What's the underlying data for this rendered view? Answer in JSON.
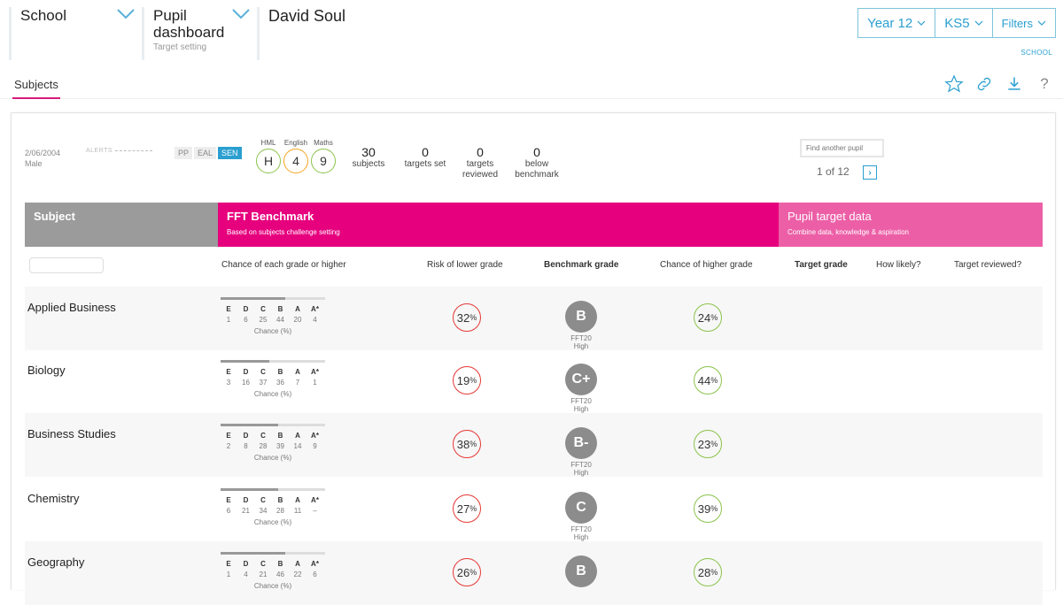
{
  "nav": {
    "school_label": "School",
    "dashboard_label": "Pupil\ndashboard",
    "dashboard_title_line1": "Pupil",
    "dashboard_title_line2": "dashboard",
    "dashboard_sub": "Target setting",
    "student_name": "David Soul",
    "year": "Year 12",
    "stage": "KS5",
    "filters": "Filters",
    "school_link": "SCHOOL"
  },
  "tabs": {
    "subjects": "Subjects"
  },
  "pupil": {
    "dob": "2/06/2004",
    "gender": "Male",
    "alerts_label": "ALERTS",
    "badges": [
      {
        "label": "PP",
        "active": false
      },
      {
        "label": "EAL",
        "active": false
      },
      {
        "label": "SEN",
        "active": true
      }
    ],
    "groups": [
      {
        "label": "HML",
        "value": "H",
        "color": "#8bc34a"
      },
      {
        "label": "English",
        "value": "4",
        "color": "#f5a623"
      },
      {
        "label": "Maths",
        "value": "9",
        "color": "#8bc34a"
      }
    ],
    "stats": [
      {
        "n": "30",
        "l1": "subjects",
        "l2": ""
      },
      {
        "n": "0",
        "l1": "targets set",
        "l2": ""
      },
      {
        "n": "0",
        "l1": "targets",
        "l2": "reviewed"
      },
      {
        "n": "0",
        "l1": "below",
        "l2": "benchmark"
      }
    ],
    "find_placeholder": "Find another pupil",
    "pager": "1 of 12"
  },
  "table": {
    "subject_header": "Subject",
    "fft_header": "FFT Benchmark",
    "fft_sub": "Based on subjects challenge setting",
    "pupil_header": "Pupil target data",
    "pupil_sub": "Combine data, knowledge & aspiration",
    "col_chance_each": "Chance of each grade or higher",
    "col_risk": "Risk of lower grade",
    "col_bench": "Benchmark grade",
    "col_higher": "Chance of higher grade",
    "col_target": "Target grade",
    "col_likely": "How likely?",
    "col_reviewed": "Target reviewed?",
    "grade_letters": [
      "E",
      "D",
      "C",
      "B",
      "A",
      "A*"
    ],
    "chance_caption": "Chance (%)",
    "rows": [
      {
        "subject": "Applied Business",
        "vals": [
          "1",
          "6",
          "25",
          "44",
          "20",
          "4"
        ],
        "bar": 0.62,
        "risk": "32",
        "bench": "B",
        "bench_src": "FFT20",
        "bench_level": "High",
        "higher": "24"
      },
      {
        "subject": "Biology",
        "vals": [
          "3",
          "16",
          "37",
          "36",
          "7",
          "1"
        ],
        "bar": 0.47,
        "risk": "19",
        "bench": "C+",
        "bench_src": "FFT20",
        "bench_level": "High",
        "higher": "44"
      },
      {
        "subject": "Business Studies",
        "vals": [
          "2",
          "8",
          "28",
          "39",
          "14",
          "9"
        ],
        "bar": 0.55,
        "risk": "38",
        "bench": "B-",
        "bench_src": "FFT20",
        "bench_level": "High",
        "higher": "23"
      },
      {
        "subject": "Chemistry",
        "vals": [
          "6",
          "21",
          "34",
          "28",
          "11",
          "–"
        ],
        "bar": 0.55,
        "risk": "27",
        "bench": "C",
        "bench_src": "FFT20",
        "bench_level": "High",
        "higher": "39"
      },
      {
        "subject": "Geography",
        "vals": [
          "1",
          "4",
          "21",
          "46",
          "22",
          "6"
        ],
        "bar": 0.62,
        "risk": "26",
        "bench": "B",
        "bench_src": "",
        "bench_level": "",
        "higher": "28"
      }
    ]
  }
}
